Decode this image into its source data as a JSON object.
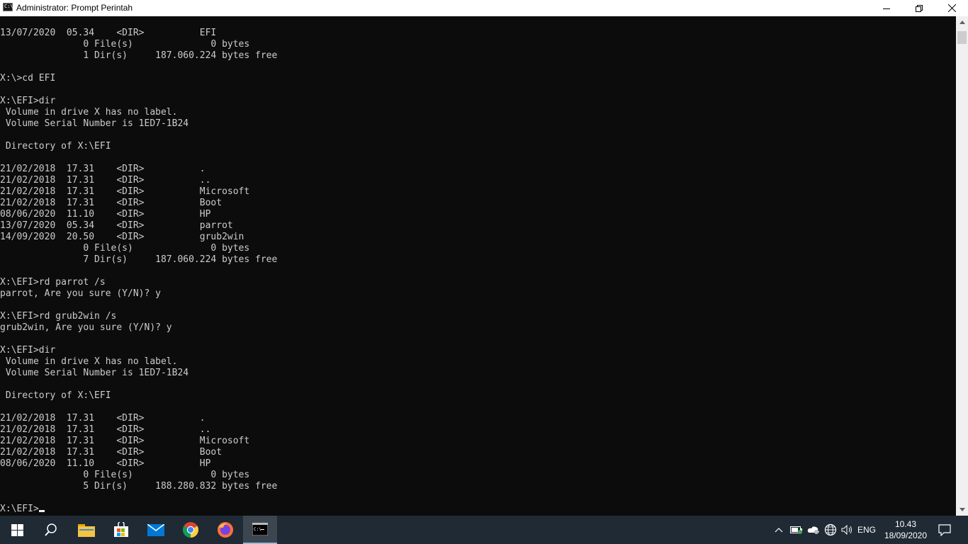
{
  "window": {
    "title": "Administrator: Prompt Perintah",
    "icon_label": "C:\\"
  },
  "console": {
    "lines": [
      "13/07/2020  05.34    <DIR>          EFI",
      "               0 File(s)              0 bytes",
      "               1 Dir(s)     187.060.224 bytes free",
      "",
      "X:\\>cd EFI",
      "",
      "X:\\EFI>dir",
      " Volume in drive X has no label.",
      " Volume Serial Number is 1ED7-1B24",
      "",
      " Directory of X:\\EFI",
      "",
      "21/02/2018  17.31    <DIR>          .",
      "21/02/2018  17.31    <DIR>          ..",
      "21/02/2018  17.31    <DIR>          Microsoft",
      "21/02/2018  17.31    <DIR>          Boot",
      "08/06/2020  11.10    <DIR>          HP",
      "13/07/2020  05.34    <DIR>          parrot",
      "14/09/2020  20.50    <DIR>          grub2win",
      "               0 File(s)              0 bytes",
      "               7 Dir(s)     187.060.224 bytes free",
      "",
      "X:\\EFI>rd parrot /s",
      "parrot, Are you sure (Y/N)? y",
      "",
      "X:\\EFI>rd grub2win /s",
      "grub2win, Are you sure (Y/N)? y",
      "",
      "X:\\EFI>dir",
      " Volume in drive X has no label.",
      " Volume Serial Number is 1ED7-1B24",
      "",
      " Directory of X:\\EFI",
      "",
      "21/02/2018  17.31    <DIR>          .",
      "21/02/2018  17.31    <DIR>          ..",
      "21/02/2018  17.31    <DIR>          Microsoft",
      "21/02/2018  17.31    <DIR>          Boot",
      "08/06/2020  11.10    <DIR>          HP",
      "               0 File(s)              0 bytes",
      "               5 Dir(s)     188.280.832 bytes free",
      ""
    ],
    "prompt": "X:\\EFI>"
  },
  "taskbar": {
    "apps": [
      {
        "name": "search-icon"
      },
      {
        "name": "file-explorer-icon"
      },
      {
        "name": "store-icon"
      },
      {
        "name": "mail-icon"
      },
      {
        "name": "chrome-icon"
      },
      {
        "name": "firefox-icon"
      },
      {
        "name": "command-prompt-icon"
      }
    ],
    "language": "ENG",
    "time": "10.43",
    "date": "18/09/2020"
  },
  "colors": {
    "console_bg": "#0c0c0c",
    "console_fg": "#cccccc",
    "taskbar_bg": "#1f2a34",
    "titlebar_bg": "#ffffff"
  }
}
